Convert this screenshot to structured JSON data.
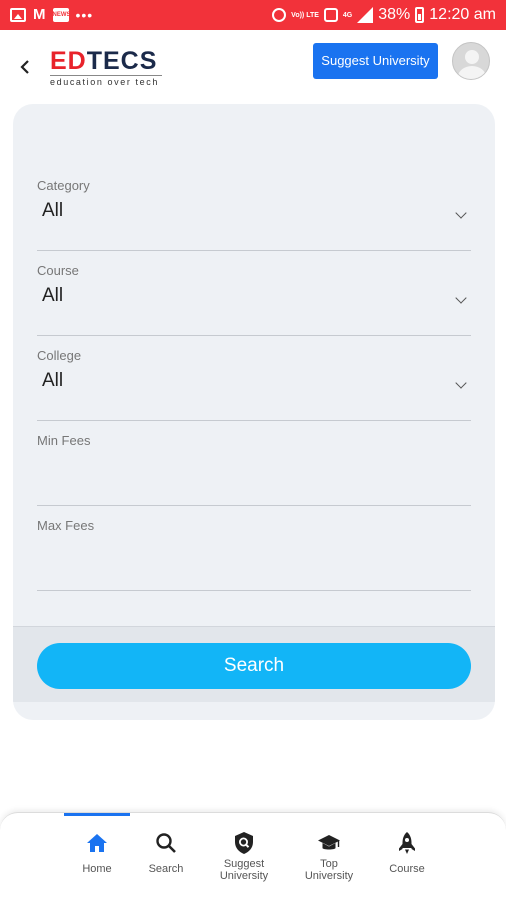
{
  "status_bar": {
    "left_icons": [
      "gallery-icon",
      "gmail-icon",
      "news-icon",
      "more-dots-icon"
    ],
    "news_icon_text": "NEWS",
    "dots": "•••",
    "volte": "Vo)) LTE",
    "lte": "4G",
    "battery_percent": "38%",
    "time": "12:20 am"
  },
  "header": {
    "logo_ed": "ED",
    "logo_tecs": "TECS",
    "logo_tagline": "education over tech",
    "suggest_button": "Suggest University"
  },
  "form": {
    "fields": [
      {
        "label": "Category",
        "value": "All",
        "type": "select"
      },
      {
        "label": "Course",
        "value": "All",
        "type": "select"
      },
      {
        "label": "College",
        "value": "All",
        "type": "select"
      },
      {
        "label": "Min Fees",
        "value": "",
        "type": "input"
      },
      {
        "label": "Max Fees",
        "value": "",
        "type": "input"
      }
    ],
    "search_button": "Search"
  },
  "bottom_nav": {
    "active": "Home",
    "items": [
      {
        "label": "Home",
        "icon": "home-icon"
      },
      {
        "label": "Search",
        "icon": "search-icon"
      },
      {
        "label_line1": "Suggest",
        "label_line2": "University",
        "icon": "shield-search-icon"
      },
      {
        "label_line1": "Top",
        "label_line2": "University",
        "icon": "graduation-cap-icon"
      },
      {
        "label": "Course",
        "icon": "rocket-icon"
      }
    ]
  },
  "colors": {
    "status_bar": "#f2323a",
    "brand_red": "#e8232b",
    "brand_navy": "#1b2a4a",
    "primary_blue": "#1a73f0",
    "search_button": "#12b5f7",
    "card_background": "#eef1f5"
  }
}
